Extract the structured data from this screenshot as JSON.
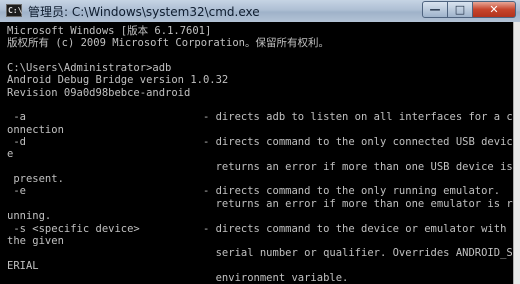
{
  "window": {
    "title": "管理员: C:\\Windows\\system32\\cmd.exe",
    "icon": "cmd-icon",
    "controls": {
      "minimize": "—",
      "maximize": "□",
      "close": "✕"
    }
  },
  "console": {
    "lines": [
      "Microsoft Windows [版本 6.1.7601]",
      "版权所有 (c) 2009 Microsoft Corporation。保留所有权利。",
      "",
      "C:\\Users\\Administrator>adb",
      "Android Debug Bridge version 1.0.32",
      "Revision 09a0d98bebce-android",
      "",
      " -a                            - directs adb to listen on all interfaces for a c",
      "onnection",
      " -d                            - directs command to the only connected USB devic",
      "e",
      "                                 returns an error if more than one USB device is",
      " present.",
      " -e                            - directs command to the only running emulator.",
      "                                 returns an error if more than one emulator is r",
      "unning.",
      " -s <specific device>          - directs command to the device or emulator with",
      "the given",
      "                                 serial number or qualifier. Overrides ANDROID_S",
      "ERIAL",
      "                                 environment variable."
    ]
  }
}
